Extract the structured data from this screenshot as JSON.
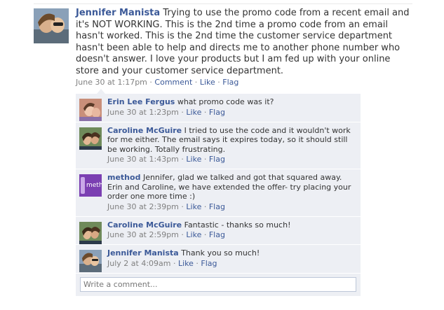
{
  "post": {
    "author": "Jennifer Manista",
    "text": "Trying to use the promo code from a recent email and it's NOT WORKING. This is the 2nd time a promo code from an email hasn't worked. This is the 2nd time the customer service department hasn't been able to help and directs me to another phone number who doesn't answer. I love your products but I am fed up with your online store and your customer service department.",
    "timestamp": "June 30 at 1:17pm",
    "sep": " · ",
    "actions": {
      "comment": "Comment",
      "like": "Like",
      "flag": "Flag"
    }
  },
  "comments": [
    {
      "author": "Erin Lee Fergus",
      "text": "what promo code was it?",
      "timestamp": "June 30 at 1:23pm",
      "like": "Like",
      "flag": "Flag",
      "sep": " · "
    },
    {
      "author": "Caroline McGuire",
      "text": "I tried to use the code and it wouldn't work for me either. The email says it expires today, so it should still be working. Totally frustrating.",
      "timestamp": "June 30 at 1:43pm",
      "like": "Like",
      "flag": "Flag",
      "sep": " · "
    },
    {
      "author": "method",
      "text": "Jennifer, glad we talked and got that squared away. Erin and Caroline, we have extended the offer- try placing your order one more time :)",
      "timestamp": "June 30 at 2:39pm",
      "like": "Like",
      "flag": "Flag",
      "sep": " · ",
      "avatar_text": "meth"
    },
    {
      "author": "Caroline McGuire",
      "text": "Fantastic - thanks so much!",
      "timestamp": "June 30 at 2:59pm",
      "like": "Like",
      "flag": "Flag",
      "sep": " · "
    },
    {
      "author": "Jennifer Manista",
      "text": "Thank you so much!",
      "timestamp": "July 2 at 4:09am",
      "like": "Like",
      "flag": "Flag",
      "sep": " · "
    }
  ],
  "write_comment": {
    "placeholder": "Write a comment..."
  }
}
